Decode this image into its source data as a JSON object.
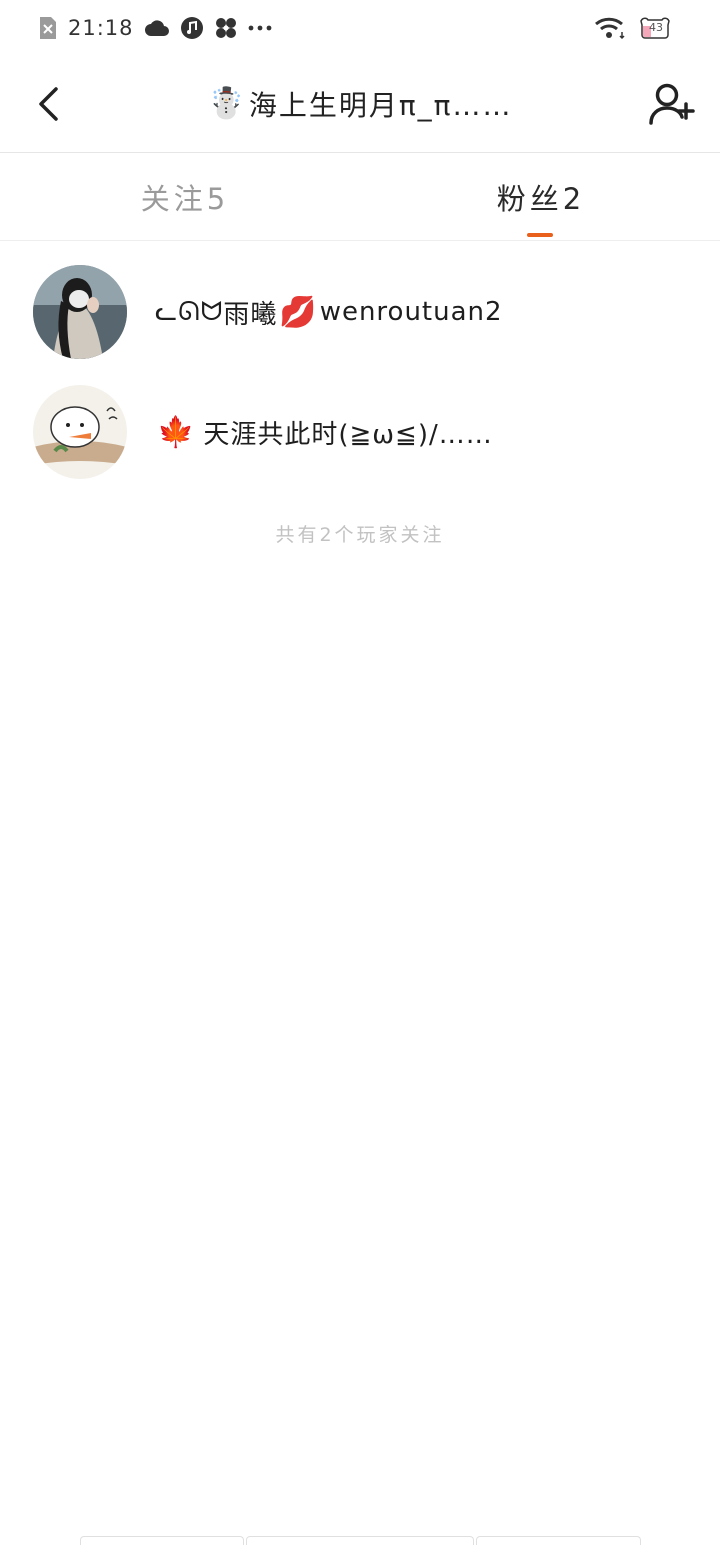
{
  "status_bar": {
    "time": "21:18",
    "battery": "43"
  },
  "header": {
    "title_emoji": "☃️",
    "title": "海上生明月π_π……"
  },
  "tabs": [
    {
      "label": "关注5",
      "active": false
    },
    {
      "label": "粉丝2",
      "active": true
    }
  ],
  "followers": [
    {
      "prefix": "ᓚᘏᗢ",
      "name_a": "雨曦",
      "emoji": "💋",
      "name_b": "wenroutuan2"
    },
    {
      "prefix": "🍁",
      "name_a": "天涯共此时(≧ω≦)/……",
      "emoji": "",
      "name_b": ""
    }
  ],
  "footer_note": "共有2个玩家关注",
  "colors": {
    "accent": "#e8601c",
    "inactive_tab": "#9a9a9a",
    "note": "#c2c2c2"
  }
}
